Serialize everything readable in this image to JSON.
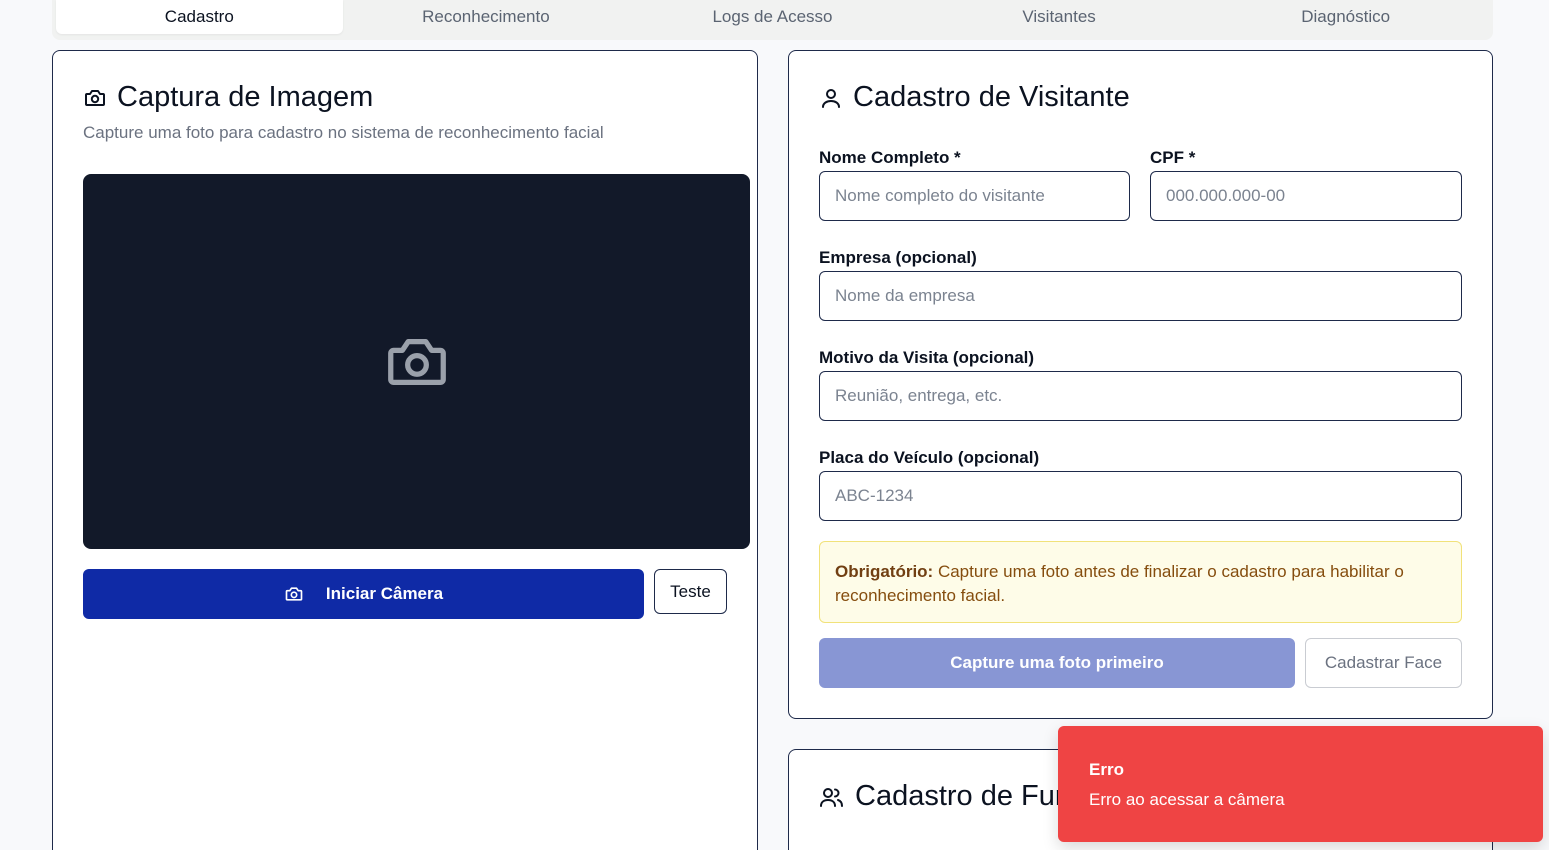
{
  "tabs": [
    {
      "label": "Cadastro",
      "active": true
    },
    {
      "label": "Reconhecimento",
      "active": false
    },
    {
      "label": "Logs de Acesso",
      "active": false
    },
    {
      "label": "Visitantes",
      "active": false
    },
    {
      "label": "Diagnóstico",
      "active": false
    }
  ],
  "capture": {
    "title": "Captura de Imagem",
    "subtitle": "Capture uma foto para cadastro no sistema de reconhecimento facial",
    "start_camera_label": "Iniciar Câmera",
    "test_label": "Teste"
  },
  "visitor": {
    "title": "Cadastro de Visitante",
    "fields": {
      "name": {
        "label": "Nome Completo *",
        "placeholder": "Nome completo do visitante"
      },
      "cpf": {
        "label": "CPF *",
        "placeholder": "000.000.000-00"
      },
      "company": {
        "label": "Empresa (opcional)",
        "placeholder": "Nome da empresa"
      },
      "reason": {
        "label": "Motivo da Visita (opcional)",
        "placeholder": "Reunião, entrega, etc."
      },
      "plate": {
        "label": "Placa do Veículo (opcional)",
        "placeholder": "ABC-1234"
      }
    },
    "notice_bold": "Obrigatório:",
    "notice_text": " Capture uma foto antes de finalizar o cadastro para habilitar o reconhecimento facial.",
    "capture_first_label": "Capture uma foto primeiro",
    "register_face_label": "Cadastrar Face"
  },
  "employee": {
    "title_visible": "Cadastro de Fun"
  },
  "toast": {
    "title": "Erro",
    "message": "Erro ao acessar a câmera"
  },
  "colors": {
    "primary": "#0f2aa6",
    "disabled": "#8896d4",
    "toast": "#ef4444",
    "preview_bg": "#121929"
  }
}
